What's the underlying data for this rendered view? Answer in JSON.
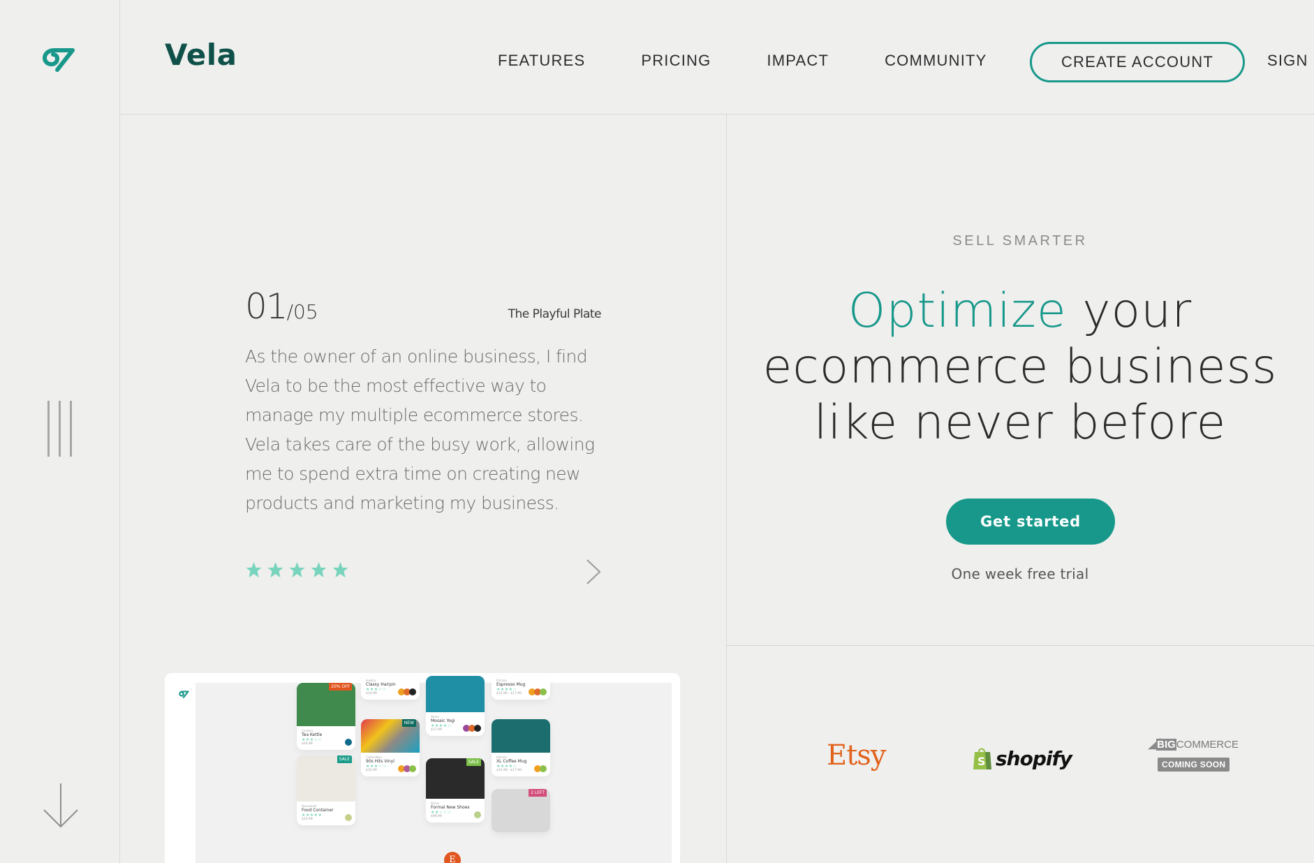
{
  "brand": {
    "name": "Vela",
    "logo_icon": "vela-swirl-logo",
    "accent_color": "#17988a",
    "brand_dark": "#0f5148"
  },
  "nav": {
    "items": [
      {
        "label": "FEATURES"
      },
      {
        "label": "PRICING"
      },
      {
        "label": "IMPACT"
      },
      {
        "label": "COMMUNITY"
      }
    ],
    "create_account_label": "CREATE ACCOUNT",
    "sign_in_label": "SIGN IN"
  },
  "sidebar": {
    "menu_icon": "three-vertical-bars-icon",
    "scroll_icon": "arrow-down-icon"
  },
  "testimonial": {
    "current": "01",
    "total": "/05",
    "source": "The Playful Plate",
    "quote": "As the owner of an online business, I find Vela to be the most effective way to manage my multiple ecommerce stores. Vela takes care of the busy work, allowing me to spend extra time on creating new products and marketing my business.",
    "rating": 5,
    "rating_max": 5,
    "star_color": "#78d4bd",
    "next_icon": "chevron-right-icon"
  },
  "preview": {
    "cards": [
      {
        "name": "Tea Kettle",
        "category": "Cookery",
        "price": "$24.99",
        "badge": "20% OFF",
        "badge_color": "#e1561f",
        "rating": 3
      },
      {
        "name": "Food Container",
        "category": "Household",
        "price": "$14.99",
        "badge": "SALE",
        "badge_color": "#1a9c8a",
        "rating": 5
      },
      {
        "name": "Classy Hairpin",
        "category": "Jewelry",
        "price": "$14.99",
        "badge": "",
        "badge_color": "",
        "rating": 3
      },
      {
        "name": "90s Hits Vinyl",
        "category": "Collectibles",
        "price": "$35.99",
        "badge": "NEW",
        "badge_color": "#0f6b5e",
        "rating": 3
      },
      {
        "name": "Mosaic Yogi",
        "category": "Home",
        "price": "$17.99",
        "badge": "",
        "badge_color": "",
        "rating": 4
      },
      {
        "name": "Formal New Shoes",
        "category": "Shoes",
        "price": "$99.99",
        "badge": "SALE",
        "badge_color": "#7cc04a",
        "rating": 2
      },
      {
        "name": "Espresso Mug",
        "category": "Kitchen",
        "price": "$15.99 - $17.99",
        "badge": "",
        "badge_color": "",
        "rating": 4
      },
      {
        "name": "XL Coffee Mug",
        "category": "Kitchen",
        "price": "$15.99 - $17.99",
        "badge": "",
        "badge_color": "",
        "rating": 4
      },
      {
        "name": "",
        "category": "",
        "price": "",
        "badge": "2 LEFT",
        "badge_color": "#d34d79",
        "rating": 0
      }
    ],
    "platform_bubble": "E"
  },
  "hero": {
    "eyebrow": "SELL SMARTER",
    "headline_accent": "Optimize",
    "headline_line1_rest": " your",
    "headline_line2": "ecommerce business",
    "headline_line3": "like never before",
    "cta_label": "Get started",
    "trial_note": "One week free trial"
  },
  "integrations": {
    "etsy": "Etsy",
    "shopify": "shopify",
    "bigcommerce_big": "BIG",
    "bigcommerce_rest": "COMMERCE",
    "bigcommerce_status": "COMING SOON"
  }
}
